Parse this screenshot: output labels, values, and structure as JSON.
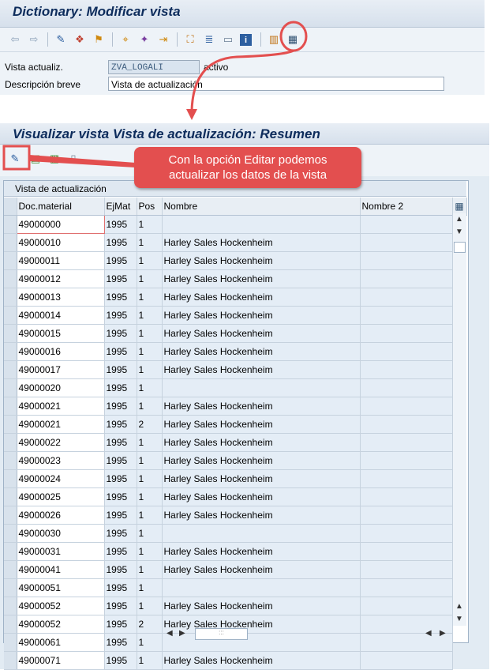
{
  "top": {
    "title": "Dictionary: Modificar vista",
    "form": {
      "vista_label": "Vista actualiz.",
      "vista_value": "ZVA_LOGALI",
      "vista_status": "activo",
      "desc_label": "Descripción breve",
      "desc_value": "Vista de actualización"
    }
  },
  "bottom": {
    "title": "Visualizar vista Vista de actualización: Resumen",
    "table_caption": "Vista de actualización",
    "columns": [
      "Doc.material",
      "EjMat",
      "Pos",
      "Nombre",
      "Nombre 2"
    ],
    "rows": [
      [
        "49000000",
        "1995",
        "1",
        "",
        ""
      ],
      [
        "49000010",
        "1995",
        "1",
        "Harley Sales Hockenheim",
        ""
      ],
      [
        "49000011",
        "1995",
        "1",
        "Harley Sales Hockenheim",
        ""
      ],
      [
        "49000012",
        "1995",
        "1",
        "Harley Sales Hockenheim",
        ""
      ],
      [
        "49000013",
        "1995",
        "1",
        "Harley Sales Hockenheim",
        ""
      ],
      [
        "49000014",
        "1995",
        "1",
        "Harley Sales Hockenheim",
        ""
      ],
      [
        "49000015",
        "1995",
        "1",
        "Harley Sales Hockenheim",
        ""
      ],
      [
        "49000016",
        "1995",
        "1",
        "Harley Sales Hockenheim",
        ""
      ],
      [
        "49000017",
        "1995",
        "1",
        "Harley Sales Hockenheim",
        ""
      ],
      [
        "49000020",
        "1995",
        "1",
        "",
        ""
      ],
      [
        "49000021",
        "1995",
        "1",
        "Harley Sales Hockenheim",
        ""
      ],
      [
        "49000021",
        "1995",
        "2",
        "Harley Sales Hockenheim",
        ""
      ],
      [
        "49000022",
        "1995",
        "1",
        "Harley Sales Hockenheim",
        ""
      ],
      [
        "49000023",
        "1995",
        "1",
        "Harley Sales Hockenheim",
        ""
      ],
      [
        "49000024",
        "1995",
        "1",
        "Harley Sales Hockenheim",
        ""
      ],
      [
        "49000025",
        "1995",
        "1",
        "Harley Sales Hockenheim",
        ""
      ],
      [
        "49000026",
        "1995",
        "1",
        "Harley Sales Hockenheim",
        ""
      ],
      [
        "49000030",
        "1995",
        "1",
        "",
        ""
      ],
      [
        "49000031",
        "1995",
        "1",
        "Harley Sales Hockenheim",
        ""
      ],
      [
        "49000041",
        "1995",
        "1",
        "Harley Sales Hockenheim",
        ""
      ],
      [
        "49000051",
        "1995",
        "1",
        "",
        ""
      ],
      [
        "49000052",
        "1995",
        "1",
        "Harley Sales Hockenheim",
        ""
      ],
      [
        "49000052",
        "1995",
        "2",
        "Harley Sales Hockenheim",
        ""
      ],
      [
        "49000061",
        "1995",
        "1",
        "",
        ""
      ],
      [
        "49000071",
        "1995",
        "1",
        "Harley Sales Hockenheim",
        ""
      ]
    ]
  },
  "callout": {
    "line1": "Con la opción Editar podemos",
    "line2": "actualizar los datos de la vista"
  },
  "colors": {
    "highlight": "#e34f4f",
    "title_text": "#0d2c5c"
  },
  "icons": {
    "top_toolbar": [
      "back-icon",
      "forward-icon",
      "display-change-icon",
      "other-object-icon",
      "activate-icon",
      "where-used-icon",
      "object-list-icon",
      "navigate-icon",
      "hierarchy-icon",
      "tech-settings-icon",
      "append-icon",
      "info-icon",
      "table-fields-icon",
      "contents-icon"
    ],
    "bottom_toolbar": [
      "edit-icon",
      "select-all-icon",
      "select-block-icon",
      "deselect-icon"
    ]
  }
}
